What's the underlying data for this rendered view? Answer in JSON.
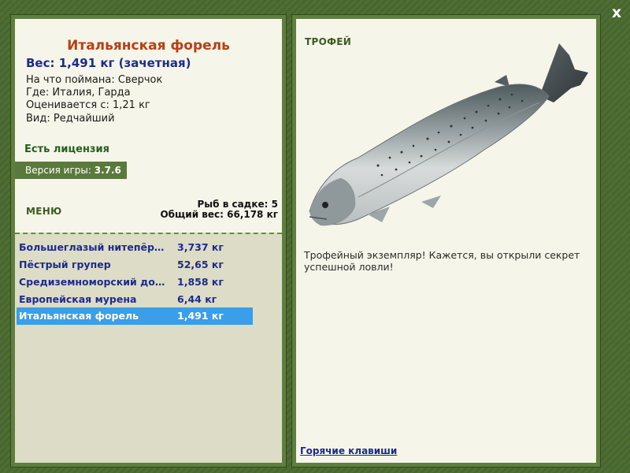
{
  "fish": {
    "title": "Итальянская форель",
    "weight_line": "Вес: 1,491 кг (зачетная)",
    "info": [
      "На что поймана: Сверчок",
      "Где: Италия, Гарда",
      "Оценивается с: 1,21 кг",
      "Вид: Редчайший"
    ]
  },
  "license": "Есть лицензия",
  "version": {
    "label": "Версия игры:",
    "value": "3.7.6"
  },
  "menu_label": "МЕНЮ",
  "keepnet": {
    "count_line": "Рыб в садке: 5",
    "total_line": "Общий вес: 66,178 кг"
  },
  "catch_list": [
    {
      "name": "Большеглазый нитепёр…",
      "weight": "3,737 кг"
    },
    {
      "name": "Пёстрый групер",
      "weight": "52,65 кг"
    },
    {
      "name": "Средиземноморский до…",
      "weight": "1,858 кг"
    },
    {
      "name": "Европейская мурена",
      "weight": "6,44 кг"
    },
    {
      "name": "Итальянская форель",
      "weight": "1,491 кг",
      "selected": true
    }
  ],
  "trophy_label": "ТРОФЕЙ",
  "description": "Трофейный экземпляр! Кажется, вы открыли секрет успешной ловли!",
  "hotkeys_label": "Горячие клавиши",
  "close_label": "x",
  "icons": {
    "close": "close-icon",
    "fish": "trout-illustration"
  },
  "colors": {
    "title": "#b44114",
    "accent_blue": "#1d2b8c",
    "selected_row": "#3a9ee8",
    "license_green": "#23611d",
    "panel_green": "#5a7a3b"
  }
}
